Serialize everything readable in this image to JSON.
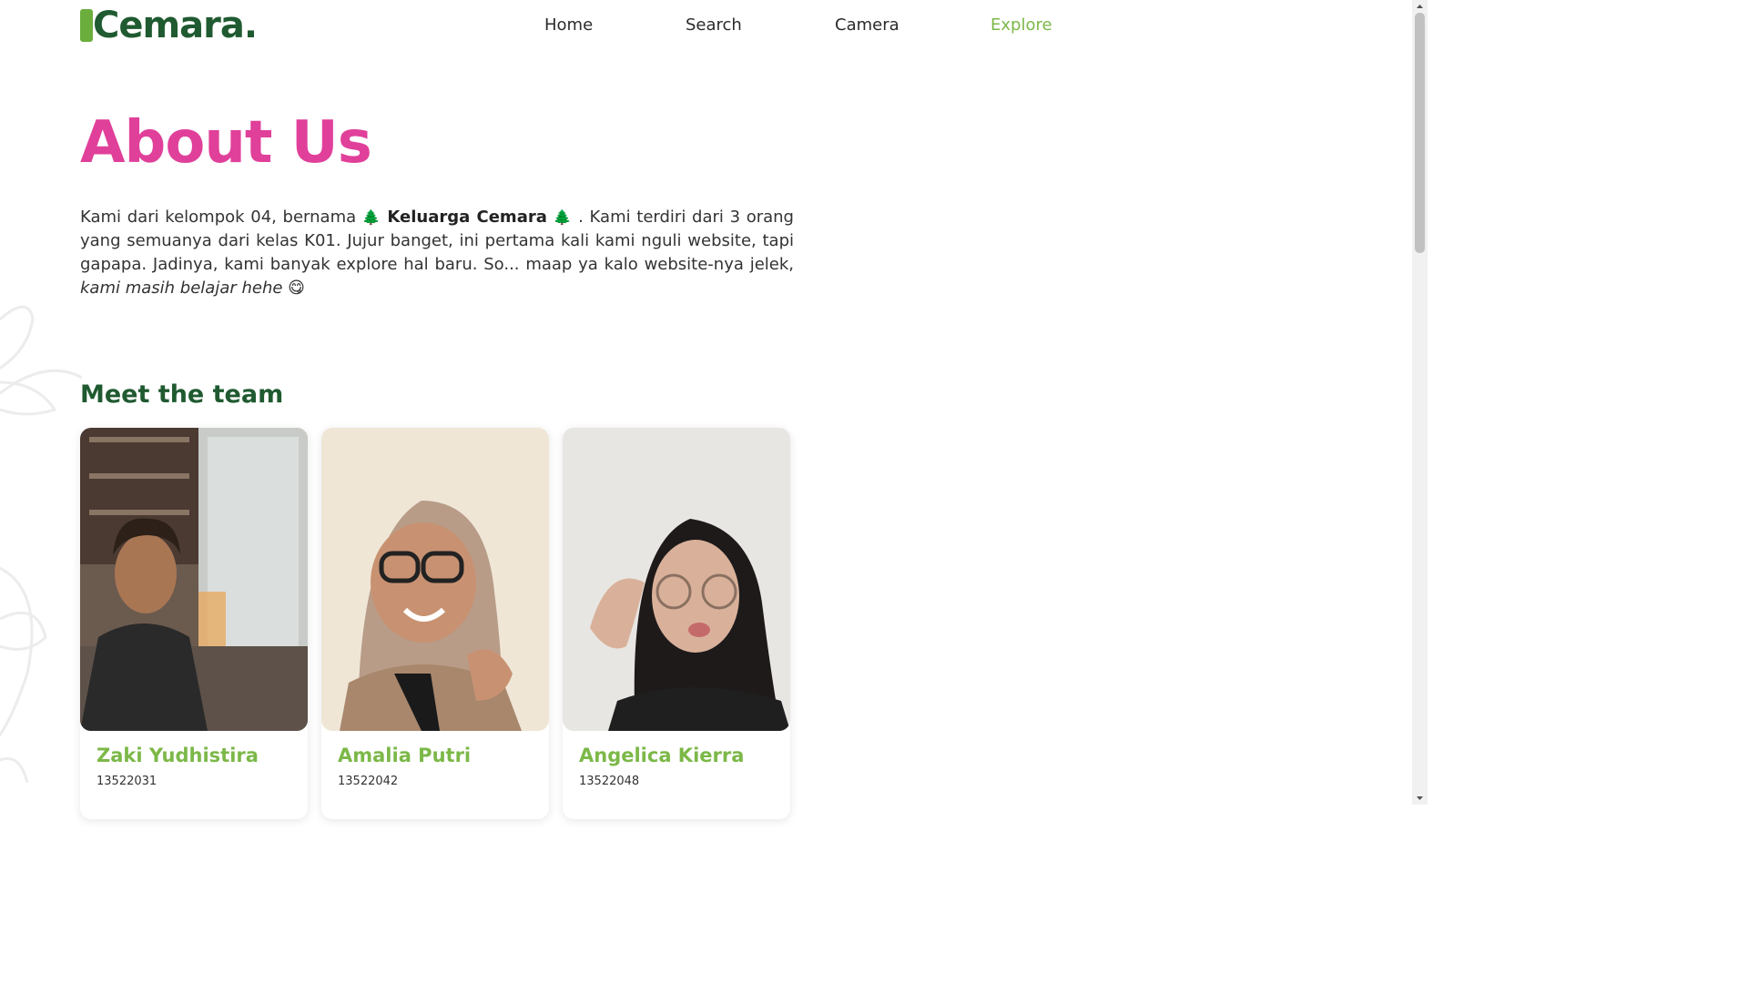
{
  "brand": {
    "logo_text": "Cemara.",
    "accent_color": "#7cb848",
    "dark_green": "#1f5a30",
    "pink": "#e0409a"
  },
  "nav": {
    "items": [
      {
        "label": "Home",
        "active": false
      },
      {
        "label": "Search",
        "active": false
      },
      {
        "label": "Camera",
        "active": false
      },
      {
        "label": "Explore",
        "active": true
      }
    ]
  },
  "page": {
    "title": "About Us",
    "intro": {
      "part1": "Kami dari kelompok 04, bernama ",
      "group_name": "Keluarga Cemara",
      "part2": ". Kami terdiri dari 3 orang yang semuanya dari kelas K01. Jujur banget, ini pertama kali kami nguli website, tapi gapapa. Jadinya, kami banyak explore hal baru. So... maap ya kalo website-nya jelek, ",
      "italic": "kami masih belajar hehe",
      "emoji": "😋",
      "tree_emoji": "🌲"
    }
  },
  "team": {
    "heading": "Meet the team",
    "members": [
      {
        "name": "Zaki Yudhistira",
        "nim": "13522031"
      },
      {
        "name": "Amalia Putri",
        "nim": "13522042"
      },
      {
        "name": "Angelica Kierra",
        "nim": "13522048"
      }
    ]
  }
}
